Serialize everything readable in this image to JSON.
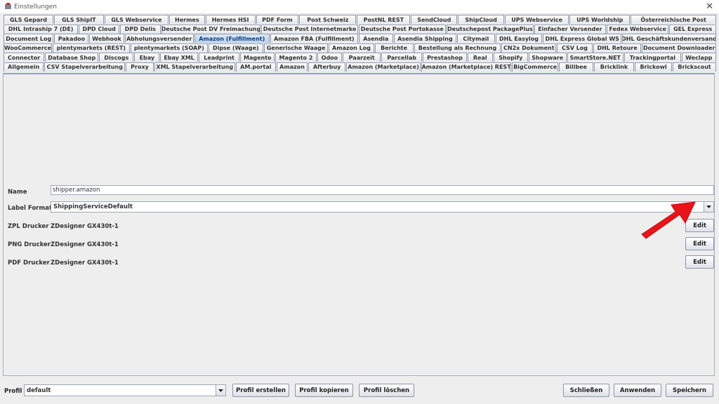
{
  "window": {
    "title": "Einstellungen"
  },
  "tabs": {
    "rows": [
      [
        "GLS Gepard",
        "GLS ShipIT",
        "GLS Webservice",
        "Hermes",
        "Hermes HSI",
        "PDF Form",
        "Post Schweiz",
        "PostNL REST",
        "SendCloud",
        "ShipCloud",
        "UPS Webservice",
        "UPS Worldship",
        "Österreichische Post"
      ],
      [
        "DHL Intraship 7 (DE)",
        "DPD Cloud",
        "DPD Delis",
        "Deutsche Post DV Freimachung",
        "Deutsche Post Internetmarke",
        "Deutsche Post Portokasse",
        "Deutschepost PackagePlus",
        "Einfacher Versender",
        "Fedex Webservice",
        "GEL Express"
      ],
      [
        "Document Log",
        "Pakadoo",
        "Webhook",
        "Abholungsversender",
        "Amazon (Fulfillment)",
        "Amazon FBA (Fulfillment)",
        "Asendia",
        "Asendia Shipping",
        "Citymail",
        "DHL Easylog",
        "DHL Express Global WS",
        "DHL Geschäftskundenversand"
      ],
      [
        "WooCommerce",
        "plentymarkets (REST)",
        "plentymarkets (SOAP)",
        "Dipse (Waage)",
        "Generische Waage",
        "Amazon Log",
        "Berichte",
        "Bestellung als Rechnung",
        "CN2x Dokument",
        "CSV Log",
        "DHL Retoure",
        "Document Downloader"
      ],
      [
        "Connector",
        "Database Shop",
        "Discogs",
        "Ebay",
        "Ebay XML",
        "Leadprint",
        "Magento",
        "Magento 2",
        "Odoo",
        "Paarzeit",
        "Parcellab",
        "Prestashop",
        "Real",
        "Shopify",
        "Shopware",
        "SmartStore.NET",
        "Trackingportal",
        "Weclapp"
      ],
      [
        "Allgemein",
        "CSV Stapelverarbeitung",
        "Proxy",
        "XML Stapelverarbeitung",
        "AM.portal",
        "Amazon",
        "Afterbuy",
        "Amazon (Marketplace)",
        "Amazon (Marketplace) REST",
        "BigCommerce",
        "Billbee",
        "Bricklink",
        "Brickowl",
        "Brickscout"
      ]
    ],
    "selected": "Amazon (Fulfillment)"
  },
  "form": {
    "name_label": "Name",
    "name_value": "shipper.amazon",
    "label_format_label": "Label Formate",
    "label_format_value": "ShippingServiceDefault",
    "zpl_label": "ZPL Drucker",
    "zpl_value": "ZDesigner GX430t-1",
    "png_label": "PNG Drucker",
    "png_value": "ZDesigner GX430t-1",
    "pdf_label": "PDF Drucker",
    "pdf_value": "ZDesigner GX430t-1",
    "edit_label": "Edit"
  },
  "footer": {
    "profile_label": "Profil",
    "profile_value": "default",
    "create_label": "Profil erstellen",
    "copy_label": "Profil kopieren",
    "delete_label": "Profil löschen",
    "close_label": "Schließen",
    "apply_label": "Anwenden",
    "save_label": "Speichern"
  },
  "colors": {
    "annotation_arrow": "#e8141b",
    "selected_tab_text": "#0b3f86"
  }
}
